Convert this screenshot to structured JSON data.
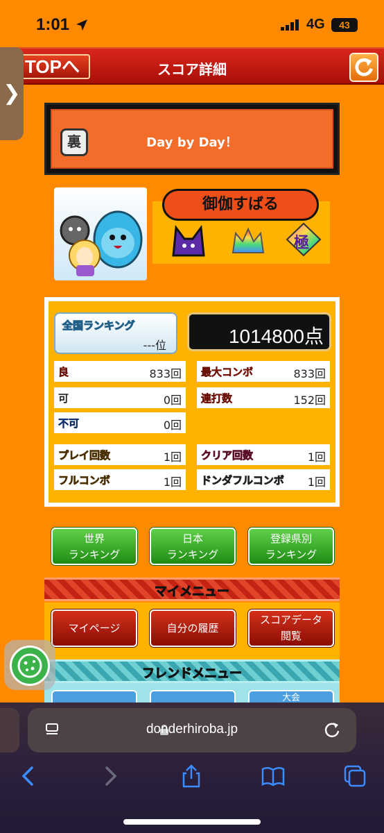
{
  "status_bar": {
    "time": "1:01",
    "network": "4G",
    "battery": "43"
  },
  "header": {
    "top_label": "TOPへ",
    "title": "スコア詳細",
    "side_tab_glyph": "❯"
  },
  "song": {
    "difficulty_icon": "裏",
    "title": "Day by Day！"
  },
  "player": {
    "name": "御伽すばる",
    "badges": [
      "crown-cat-badge",
      "rainbow-crown-badge",
      "kiwami-badge"
    ],
    "kiwami_label": "極"
  },
  "ranking": {
    "label": "全国ランキング",
    "value": "---位"
  },
  "score": {
    "points": "1014800点"
  },
  "stats": [
    {
      "key": "good",
      "label": "良",
      "value": "833回",
      "color": "#d52a16"
    },
    {
      "key": "max_combo",
      "label": "最大コンボ",
      "value": "833回",
      "color": "#d52a16"
    },
    {
      "key": "ok",
      "label": "可",
      "value": "0回",
      "color": "#222222"
    },
    {
      "key": "drumroll",
      "label": "連打数",
      "value": "152回",
      "color": "#d52a16"
    },
    {
      "key": "bad",
      "label": "不可",
      "value": "0回",
      "color": "#2a6ad6"
    },
    {
      "key": "play_count",
      "label": "プレイ回数",
      "value": "1回",
      "color": "#f2c300"
    },
    {
      "key": "clear_count",
      "label": "クリア回数",
      "value": "1回",
      "color": "#e44a7a"
    },
    {
      "key": "full_combo",
      "label": "フルコンボ",
      "value": "1回",
      "color": "#f2c300"
    },
    {
      "key": "donderful_combo",
      "label": "ドンダフルコンボ",
      "value": "1回",
      "color": "#ffffff"
    }
  ],
  "ranking_buttons": [
    {
      "line1": "世界",
      "line2": "ランキング"
    },
    {
      "line1": "日本",
      "line2": "ランキング"
    },
    {
      "line1": "登録県別",
      "line2": "ランキング"
    }
  ],
  "my_menu": {
    "title": "マイメニュー",
    "buttons": [
      {
        "line1": "マイページ",
        "line2": ""
      },
      {
        "line1": "自分の履歴",
        "line2": ""
      },
      {
        "line1": "スコアデータ",
        "line2": "閲覧"
      }
    ]
  },
  "friend_menu": {
    "title": "フレンドメニュー",
    "buttons": [
      "",
      "",
      "大会"
    ]
  },
  "browser": {
    "url": "donderhiroba.jp"
  },
  "colors": {
    "background": "#ff8a00",
    "header": "#c01a10",
    "panel": "#ffb300",
    "green_button": "#3fb02e",
    "red_button": "#b81e10"
  }
}
